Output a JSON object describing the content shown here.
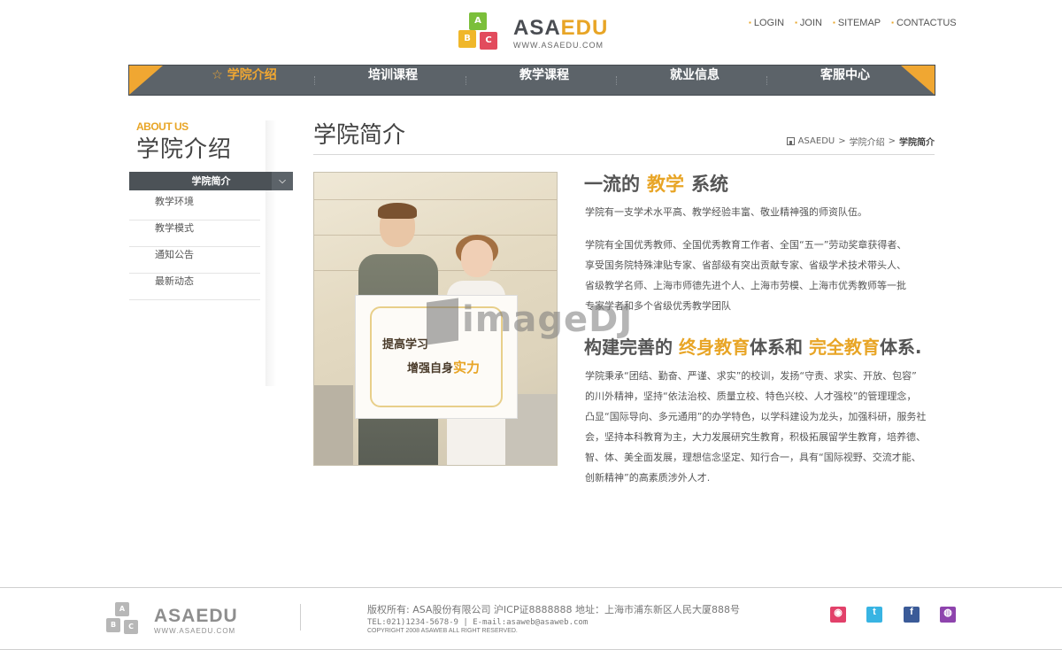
{
  "header": {
    "brand_asa": "ASA",
    "brand_edu": "EDU",
    "url": "WWW.ASAEDU.COM",
    "cube_letters": [
      "A",
      "B",
      "C"
    ],
    "toplinks": [
      "LOGIN",
      "JOIN",
      "SITEMAP",
      "CONTACTUS"
    ]
  },
  "nav": {
    "items": [
      "☆ 学院介绍",
      "培训课程",
      "教学课程",
      "就业信息",
      "客服中心"
    ],
    "active_index": 0,
    "accent": "#f0a732",
    "bar_color": "#5c6369"
  },
  "sidebar": {
    "about": "ABOUT US",
    "title": "学院介绍",
    "active": "学院简介",
    "items": [
      "教学环境",
      "教学模式",
      "通知公告",
      "最新动态"
    ]
  },
  "content": {
    "page_title": "学院简介",
    "breadcrumb": [
      "ASAEDU",
      "学院介绍",
      "学院简介"
    ],
    "picture": {
      "line1": "提高学习",
      "line2_a": "增强自身",
      "line2_b": "实力"
    },
    "section1": {
      "h_a": "一流的",
      "h_hl": "教学",
      "h_b": "系统",
      "p1": "学院有一支学术水平高、教学经验丰富、敬业精神强的师资队伍。",
      "p2": [
        "学院有全国优秀教师、全国优秀教育工作者、全国“五一”劳动奖章获得者、",
        "享受国务院特殊津贴专家、省部级有突出贡献专家、省级学术技术带头人、",
        "省级教学名师、上海市师德先进个人、上海市劳模、上海市优秀教师等一批",
        "专家学者和多个省级优秀教学团队"
      ]
    },
    "section2": {
      "h_a": "构建完善的",
      "h_hl1": "终身教育",
      "h_b": "体系和",
      "h_hl2": "完全教育",
      "h_c": "体系.",
      "p": [
        "学院秉承“团结、勤奋、严谨、求实”的校训，发扬“守责、求实、开放、包容”",
        "的川外精神，坚持“依法治校、质量立校、特色兴校、人才强校”的管理理念，",
        "凸显“国际导向、多元通用”的办学特色，以学科建设为龙头，加强科研，服务社",
        "会，坚持本科教育为主，大力发展研究生教育，积极拓展留学生教育，培养德、",
        "智、体、美全面发展，理想信念坚定、知行合一，具有“国际视野、交流才能、",
        "创新精神”的高素质涉外人才."
      ]
    }
  },
  "watermark": "imageDJ",
  "footer": {
    "brand": "ASAEDU",
    "url": "WWW.ASAEDU.COM",
    "line1": "版权所有: ASA股份有限公司 沪ICP证8888888 地址：上海市浦东新区人民大厦888号",
    "line2": "TEL:021)1234-5678-9  | E-mail:asaweb@asaweb.com",
    "line3": "COPYRIGHT 2008 ASAWEB ALL RIGHT RESERVED.",
    "social": [
      {
        "icon": "weibo-icon",
        "glyph": "◉",
        "color": "#e2416a"
      },
      {
        "icon": "twitter-icon",
        "glyph": "t",
        "color": "#38b4e3"
      },
      {
        "icon": "facebook-icon",
        "glyph": "f",
        "color": "#3b5b98"
      },
      {
        "icon": "chat-icon",
        "glyph": "◍",
        "color": "#8e44ad"
      }
    ]
  }
}
